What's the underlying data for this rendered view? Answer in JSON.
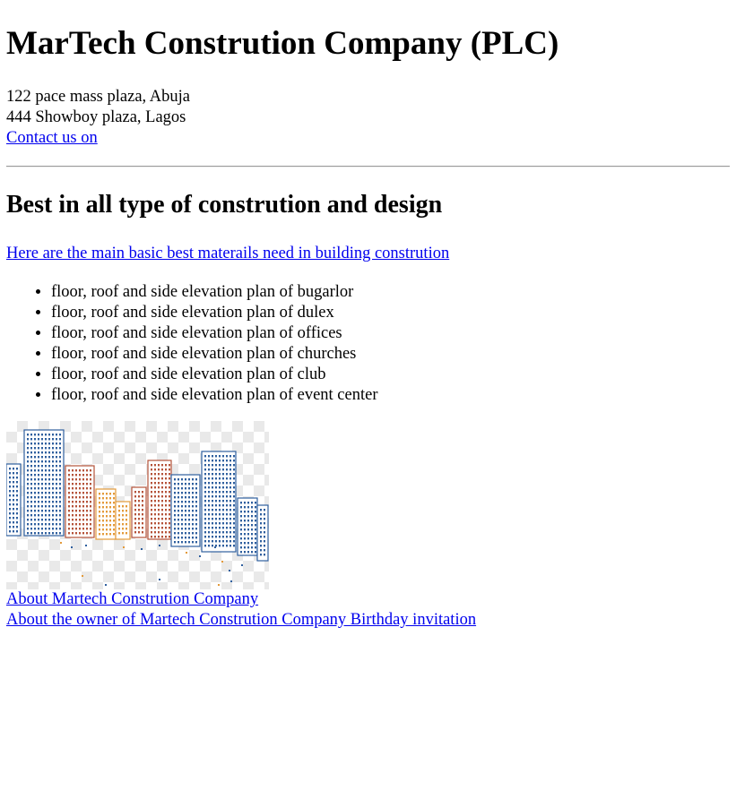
{
  "header": {
    "title": "MarTech Constrution Company (PLC)",
    "address_1": "122 pace mass plaza, Abuja",
    "address_2": "444 Showboy plaza, Lagos",
    "contact_link": "Contact us on"
  },
  "main": {
    "heading": "Best in all type of constrution and design",
    "intro_link": "Here are the main basic best materails need in building constrution",
    "plans": [
      "floor, roof and side elevation plan of bugarlor",
      "floor, roof and side elevation plan of dulex",
      "floor, roof and side elevation plan of offices",
      "floor, roof and side elevation plan of churches",
      "floor, roof and side elevation plan of club",
      "floor, roof and side elevation plan of event center"
    ],
    "image": {
      "icon": "city-buildings-illustration"
    }
  },
  "footer": {
    "about_company": "About Martech Constrution Company",
    "about_owner": "About the owner of Martech Constrution Company Birthday invitation"
  },
  "colors": {
    "link": "#0000ee",
    "text": "#000000",
    "building_blue": "#2f5f9e",
    "building_orange": "#e39a3a",
    "building_red": "#b5533a"
  }
}
